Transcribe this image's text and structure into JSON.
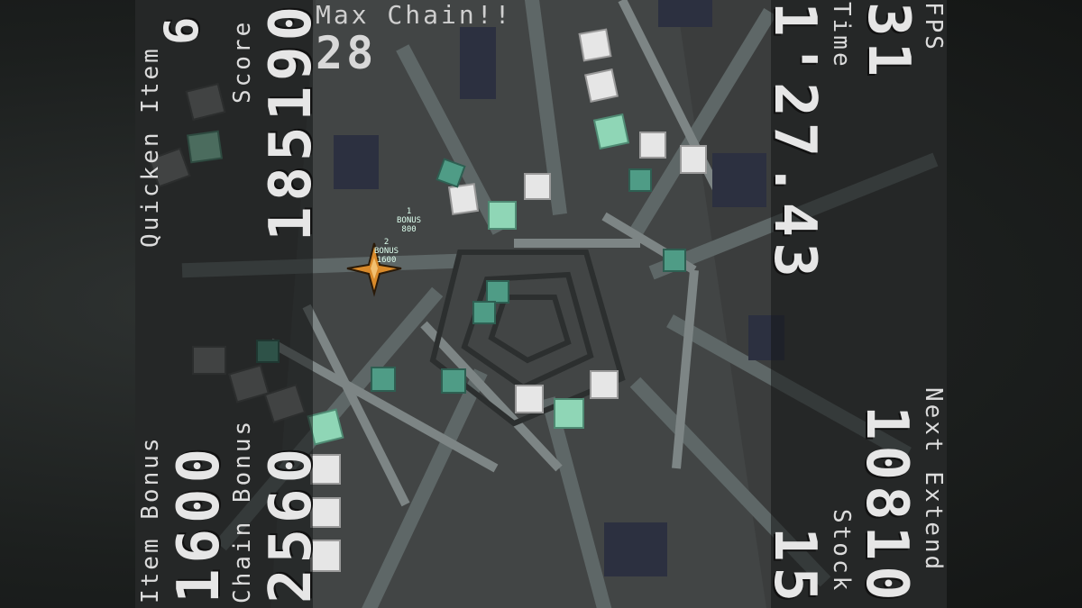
{
  "hud": {
    "quicken_item_label": "Quicken Item",
    "quicken_item_value": "6",
    "score_label": "Score",
    "score_value": "185190",
    "max_chain_label": "Max Chain!!",
    "max_chain_value": "28",
    "fps_label": "FPS",
    "fps_value": "31",
    "time_label": "Time",
    "time_value": "1'27.43",
    "item_bonus_label": "Item Bonus",
    "item_bonus_value": "1600",
    "chain_bonus_label": "Chain Bonus",
    "chain_bonus_value": "2560",
    "next_extend_label": "Next Extend",
    "next_extend_value": "10810",
    "stock_label": "Stock",
    "stock_value": "15"
  },
  "popups": [
    {
      "line1": "1",
      "line2": "BONUS",
      "line3": "800"
    },
    {
      "line1": "2",
      "line2": "BONUS",
      "line3": "1600"
    }
  ],
  "colors": {
    "cube_white": "#e8e8e8",
    "cube_green": "#8fd6b6",
    "cube_gray": "#6f7372",
    "cube_dark_green": "#3d6e5c",
    "player_ship": "#d98a2a"
  }
}
